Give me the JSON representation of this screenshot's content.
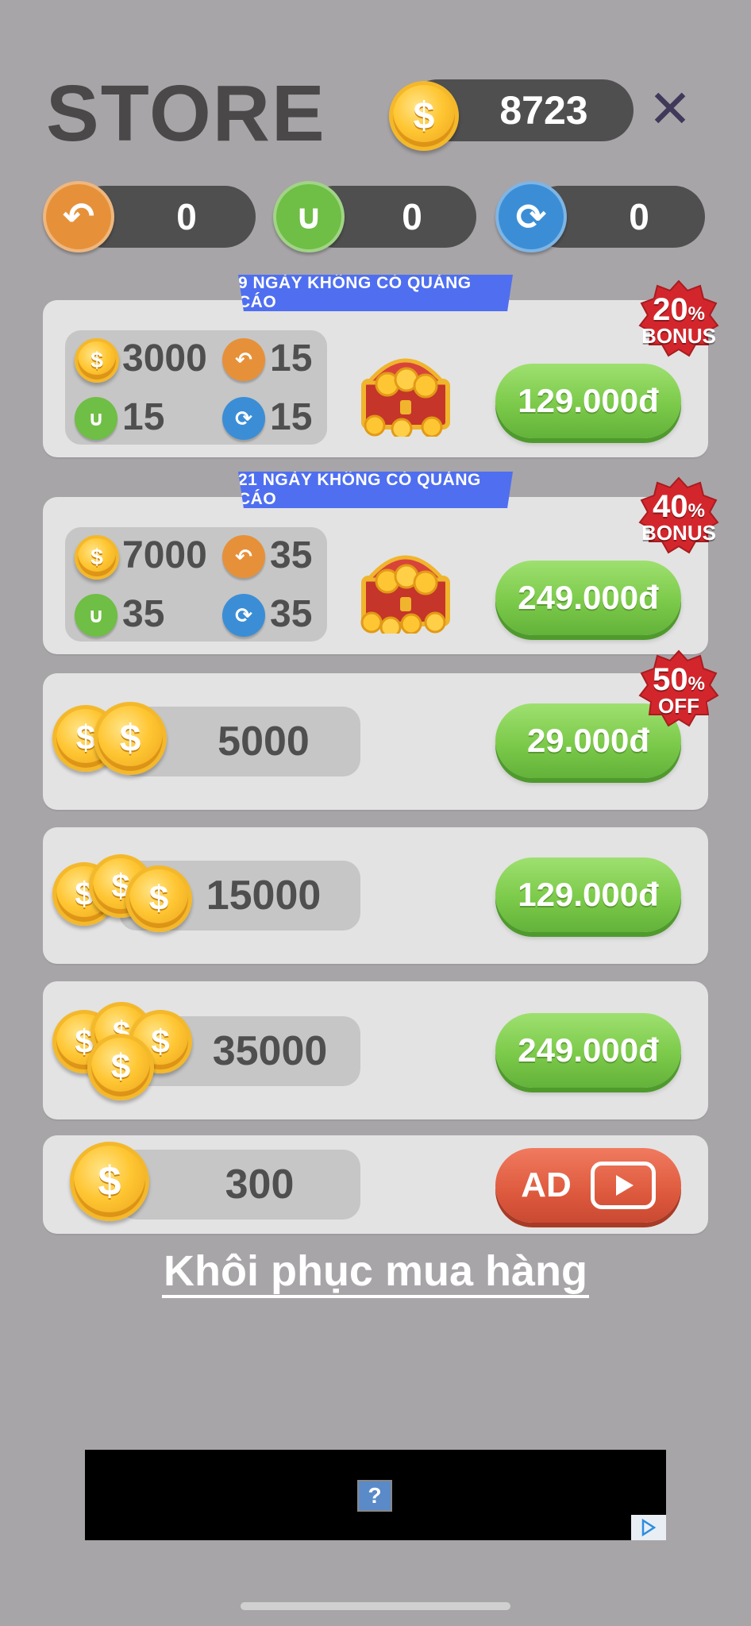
{
  "header": {
    "title": "STORE",
    "coins": "8723",
    "close_icon": "✕"
  },
  "powerups": [
    {
      "icon": "undo-icon",
      "count": "0",
      "color": "#e6913a"
    },
    {
      "icon": "magnet-icon",
      "count": "0",
      "color": "#6fbe45"
    },
    {
      "icon": "shuffle-icon",
      "count": "0",
      "color": "#3b8ed6"
    }
  ],
  "bundles": [
    {
      "ribbon": "9 NGÀY KHÔNG CÓ QUẢNG CÁO",
      "coins": "3000",
      "undo": "15",
      "magnet": "15",
      "shuffle": "15",
      "price": "129.000đ",
      "badge_value": "20",
      "badge_unit": "%",
      "badge_label": "BONUS"
    },
    {
      "ribbon": "21 NGÀY KHÔNG CÓ QUẢNG CÁO",
      "coins": "7000",
      "undo": "35",
      "magnet": "35",
      "shuffle": "35",
      "price": "249.000đ",
      "badge_value": "40",
      "badge_unit": "%",
      "badge_label": "BONUS"
    }
  ],
  "coin_packs": [
    {
      "amount": "5000",
      "price": "29.000đ",
      "badge_value": "50",
      "badge_unit": "%",
      "badge_label": "OFF"
    },
    {
      "amount": "15000",
      "price": "129.000đ"
    },
    {
      "amount": "35000",
      "price": "249.000đ"
    }
  ],
  "ad_reward": {
    "amount": "300",
    "button_label": "AD"
  },
  "restore_label": "Khôi phục mua hàng",
  "ad_banner": {
    "placeholder": "?"
  },
  "colors": {
    "background": "#a8a5a8",
    "card": "#e3e3e3",
    "green_button": "#7cca4a",
    "red_button": "#de5a3e",
    "ribbon": "#4f6ff0",
    "badge": "#d3262c"
  }
}
